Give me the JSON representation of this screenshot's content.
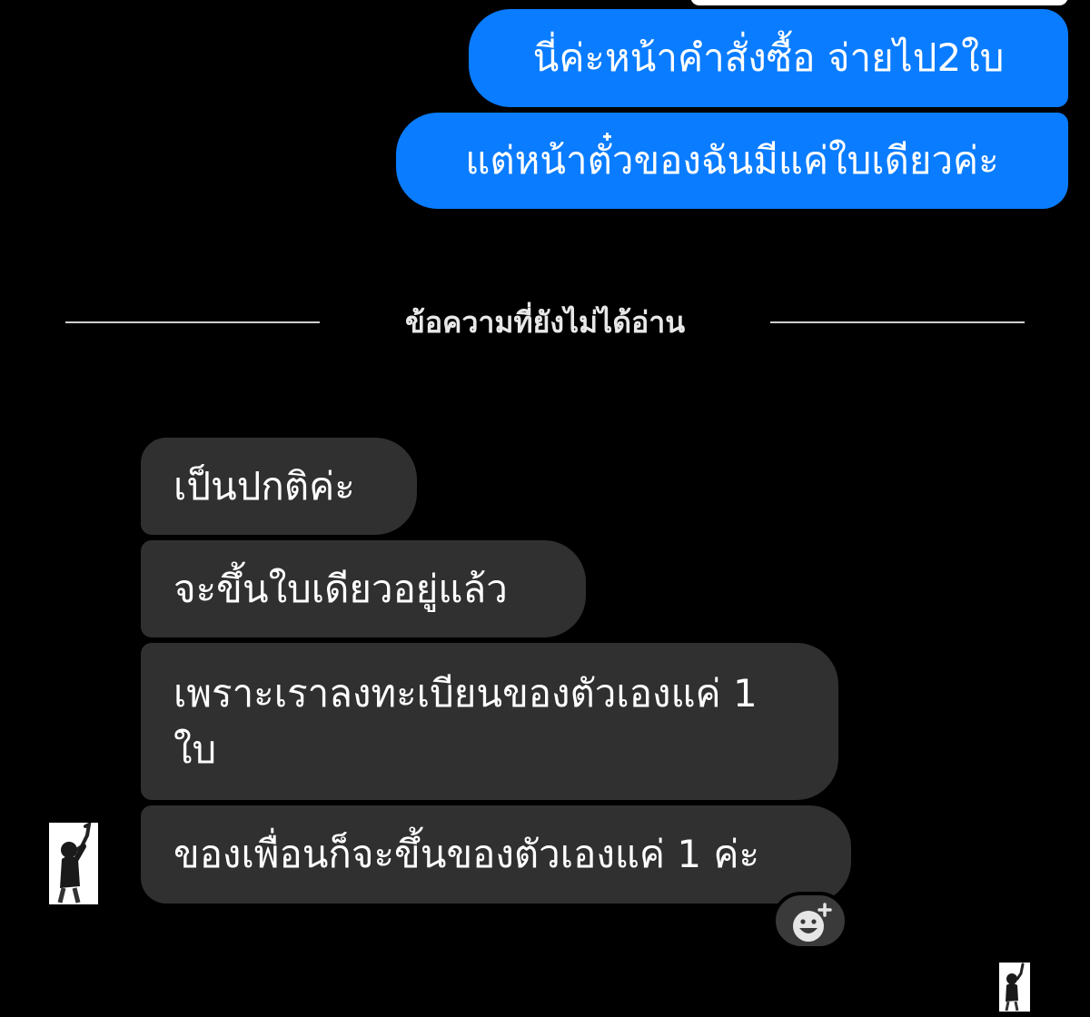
{
  "conversation": {
    "outgoing": [
      {
        "text": "นี่ค่ะหน้าคำสั่งซื้อ จ่ายไป2ใบ"
      },
      {
        "text": "แต่หน้าตั๋วของฉันมีแค่ใบเดียวค่ะ"
      }
    ],
    "unread_divider": "ข้อความที่ยังไม่ได้อ่าน",
    "incoming": [
      {
        "text": "เป็นปกติค่ะ"
      },
      {
        "text": "จะขึ้นใบเดียวอยู่แล้ว"
      },
      {
        "text": "เพราะเราลงทะเบียนของตัวเองแค่ 1 ใบ"
      },
      {
        "text": "ของเพื่อนก็จะขึ้นของตัวเองแค่ 1 ค่ะ"
      }
    ]
  },
  "icons": {
    "react": "add-reaction-icon",
    "avatar": "contact-avatar"
  },
  "colors": {
    "background": "#000000",
    "outgoing_bubble": "#0a7cff",
    "incoming_bubble": "#303030",
    "text": "#ffffff"
  }
}
